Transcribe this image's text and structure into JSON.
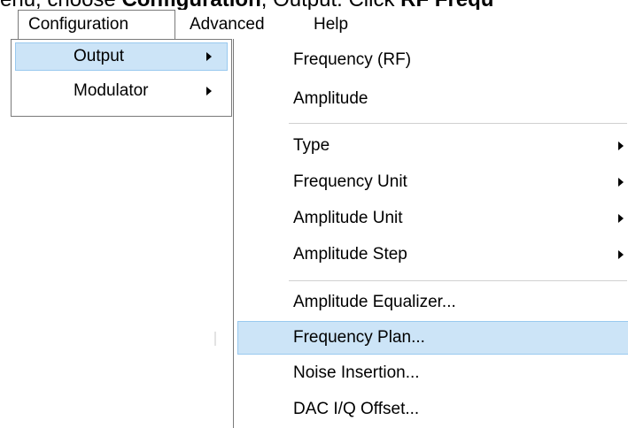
{
  "instruction": {
    "prefix": "enu, choose ",
    "bold": "Configuration",
    "middle": ", Output. Click ",
    "bold2": "RF Frequ"
  },
  "menubar": {
    "items": [
      "Configuration",
      "Advanced",
      "Help"
    ]
  },
  "configuration_menu": {
    "items": [
      {
        "label": "Output",
        "has_submenu": true,
        "highlighted": true
      },
      {
        "label": "Modulator",
        "has_submenu": true,
        "highlighted": false
      }
    ]
  },
  "output_menu": {
    "items": [
      {
        "label": "Frequency (RF)",
        "has_submenu": false
      },
      {
        "label": "Amplitude",
        "has_submenu": false
      },
      {
        "label": "Type",
        "has_submenu": true
      },
      {
        "label": "Frequency Unit",
        "has_submenu": true
      },
      {
        "label": "Amplitude Unit",
        "has_submenu": true
      },
      {
        "label": "Amplitude Step",
        "has_submenu": true
      },
      {
        "label": "Amplitude Equalizer...",
        "has_submenu": false
      },
      {
        "label": "Frequency Plan...",
        "has_submenu": false,
        "highlighted": true
      },
      {
        "label": "Noise Insertion...",
        "has_submenu": false
      },
      {
        "label": "DAC I/Q Offset...",
        "has_submenu": false
      }
    ]
  },
  "colors": {
    "highlight_bg": "#cce4f7",
    "highlight_border": "#99c9ef",
    "menu_border": "#7a7a7a",
    "separator": "#d0d0d0"
  }
}
